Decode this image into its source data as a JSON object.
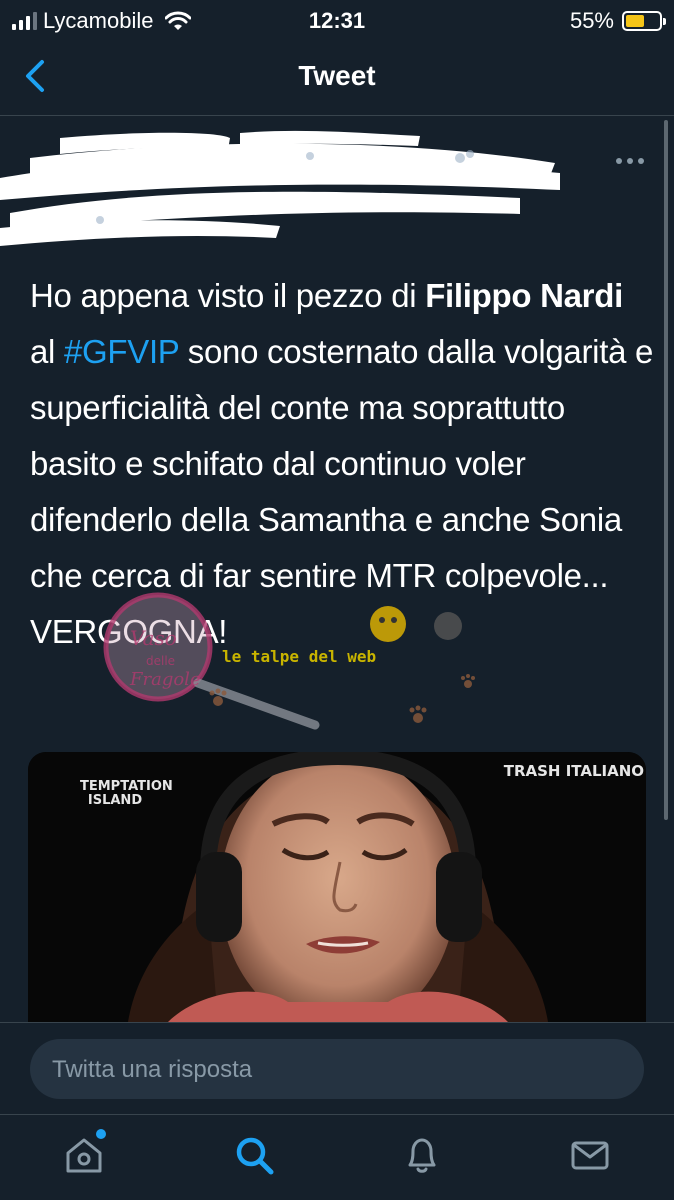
{
  "status_bar": {
    "carrier": "Lycamobile",
    "time": "12:31",
    "battery_percent": "55%",
    "battery_level": 0.55
  },
  "nav": {
    "title": "Tweet"
  },
  "tweet": {
    "text_parts": {
      "p1": "Ho appena visto il pezzo di ",
      "bold1": "Filippo Nardi",
      "p2": " al ",
      "hashtag": "#GFVIP",
      "p3": " sono costernato dalla volgarità e superficialità del conte ma soprattutto basito e schifato dal continuo voler difenderlo della Samantha e anche Sonia che cerca di far sentire MTR colpevole... VERGOGNA!"
    },
    "media": {
      "label_left": "TEMPTATION ISLAND",
      "label_right": "TRASH ITALIANO"
    }
  },
  "watermarks": {
    "left": "Vaso delle Fragole",
    "right": "le talpe del web"
  },
  "reply": {
    "placeholder": "Twitta una risposta"
  },
  "colors": {
    "background": "#15202b",
    "accent": "#1da1f2",
    "muted": "#8899a6",
    "battery": "#f5c518"
  },
  "icons": [
    "back-chevron-icon",
    "more-dots-icon",
    "home-icon",
    "search-icon",
    "bell-icon",
    "mail-icon"
  ]
}
